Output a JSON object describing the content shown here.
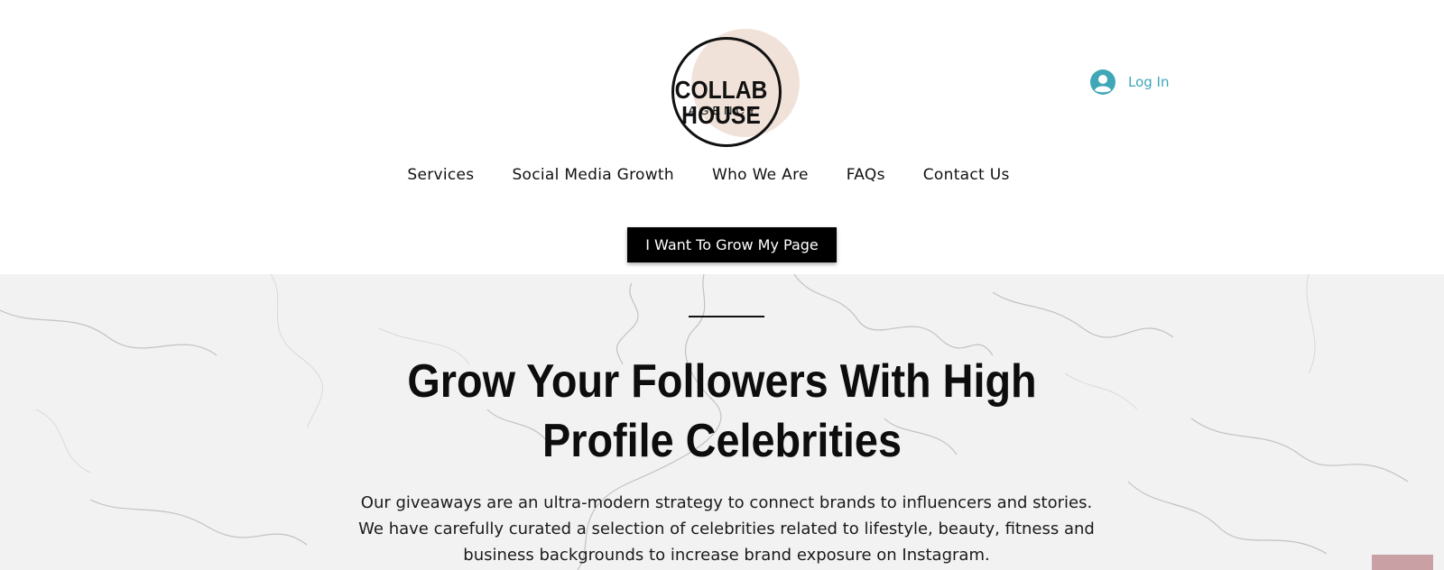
{
  "brand": {
    "title": "COLLAB HOUSE",
    "subtitle": "AGENCY",
    "blob_color": "#f0e2d9"
  },
  "header": {
    "login_label": "Log In",
    "login_icon": "user-avatar-icon",
    "accent_color": "#3fa7b7"
  },
  "nav": {
    "items": [
      {
        "label": "Services"
      },
      {
        "label": "Social Media Growth"
      },
      {
        "label": "Who We Are"
      },
      {
        "label": "FAQs"
      },
      {
        "label": "Contact Us"
      }
    ]
  },
  "cta": {
    "label": "I Want To Grow My Page"
  },
  "hero": {
    "title_line1": "Grow Your Followers With High",
    "title_line2": "Profile Celebrities",
    "body": "Our giveaways are an ultra-modern strategy to connect brands to influencers and stories. We have carefully curated a selection of celebrities related to lifestyle, beauty, fitness and business backgrounds to increase brand exposure on Instagram.",
    "background": "white marble texture"
  }
}
